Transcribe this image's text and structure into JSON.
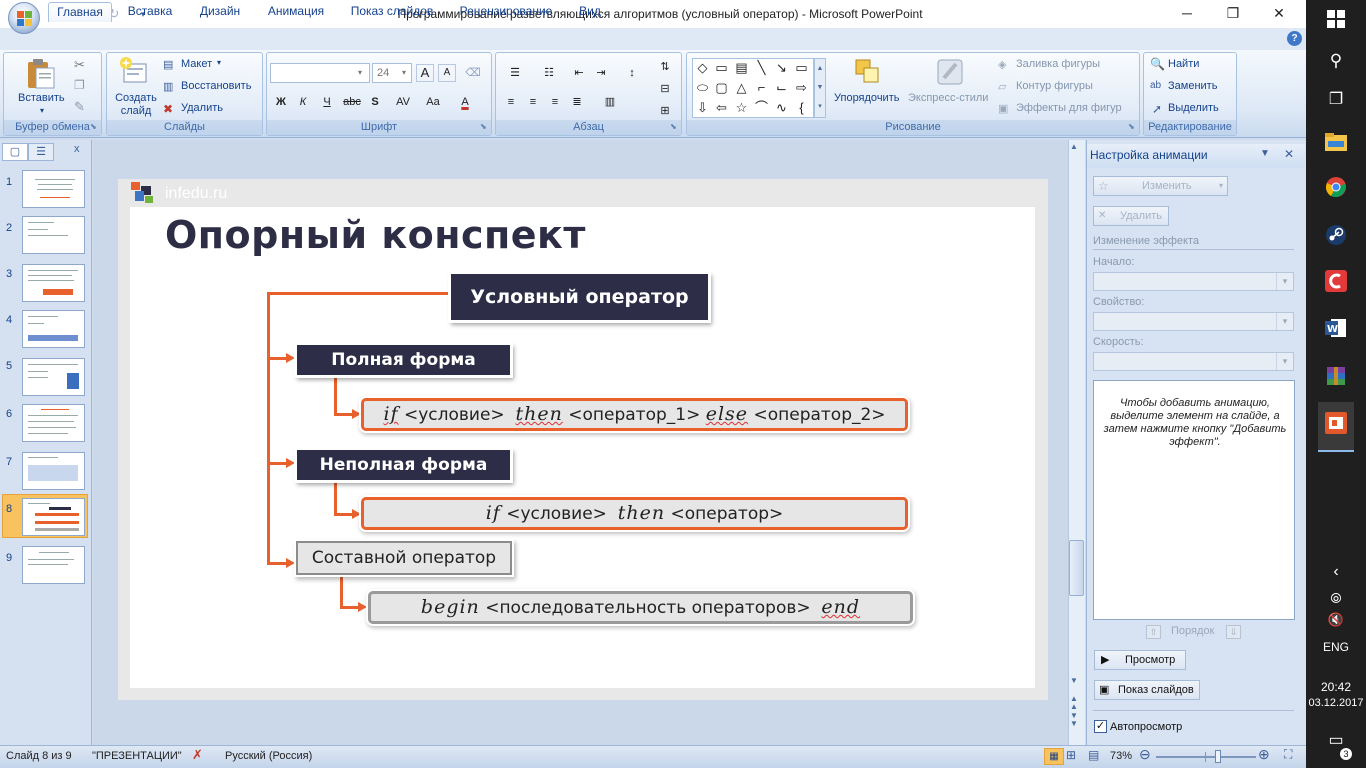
{
  "app": {
    "window_title": "Программирование разветвляющихся алгоритмов (условный оператор) - Microsoft PowerPoint",
    "minimize_glyph": "─",
    "maximize_glyph": "❐",
    "close_glyph": "✕"
  },
  "tabs": [
    "Главная",
    "Вставка",
    "Дизайн",
    "Анимация",
    "Показ слайдов",
    "Рецензирование",
    "Вид"
  ],
  "ribbon": {
    "clipboard": {
      "paste_label": "Вставить",
      "group_label": "Буфер обмена"
    },
    "slides": {
      "new_slide_label": "Создать слайд",
      "layout_label": "Макет",
      "reset_label": "Восстановить",
      "delete_label": "Удалить",
      "group_label": "Слайды"
    },
    "font": {
      "font_name": "",
      "font_size": "24",
      "group_label": "Шрифт",
      "bold": "Ж",
      "italic": "К",
      "underline": "Ч",
      "strike": "abc",
      "shadow": "S",
      "spacing": "AV",
      "case": "Aa",
      "grow": "A",
      "shrink": "A",
      "color": "A"
    },
    "paragraph": {
      "group_label": "Абзац"
    },
    "drawing": {
      "arrange_label": "Упорядочить",
      "quick_styles_label": "Экспресс-стили",
      "fill_label": "Заливка фигуры",
      "outline_label": "Контур фигуры",
      "effects_label": "Эффекты для фигур",
      "group_label": "Рисование"
    },
    "editing": {
      "find_label": "Найти",
      "replace_label": "Заменить",
      "select_label": "Выделить",
      "group_label": "Редактирование"
    }
  },
  "slides_pane": {
    "slide_numbers": [
      "1",
      "2",
      "3",
      "4",
      "5",
      "6",
      "7",
      "8",
      "9"
    ],
    "selected": 8
  },
  "slide": {
    "site_label": "infedu.ru",
    "title": "Опорный конспект",
    "root_box": "Условный оператор",
    "full_form": "Полная форма",
    "full_syntax": {
      "if": "if",
      "cond": "<условие>",
      "then": "then",
      "op1": "<оператор_1>",
      "else": "else",
      "op2": "<оператор_2>"
    },
    "partial_form": "Неполная форма",
    "partial_syntax": {
      "if": "if",
      "cond": "<условие>",
      "then": "then",
      "op": "<оператор>"
    },
    "compound": "Составной оператор",
    "compound_syntax": {
      "begin": "begin",
      "seq": "<последовательность операторов>",
      "end": "end"
    }
  },
  "task_pane": {
    "title": "Настройка анимации",
    "change_btn": "Изменить",
    "delete_btn": "Удалить",
    "effect_header": "Изменение эффекта",
    "start_label": "Начало:",
    "property_label": "Свойство:",
    "speed_label": "Скорость:",
    "hint": "Чтобы добавить анимацию, выделите элемент на слайде, а затем нажмите кнопку \"Добавить эффект\".",
    "order_label": "Порядок",
    "preview_btn": "Просмотр",
    "slideshow_btn": "Показ слайдов",
    "autopreview_label": "Автопросмотр"
  },
  "status": {
    "slide_info": "Слайд 8 из 9",
    "theme": "\"ПРЕЗЕНТАЦИИ\"",
    "language": "Русский (Россия)",
    "zoom": "73%",
    "zoom_level": 0.62
  },
  "taskbar": {
    "lang": "ENG",
    "time": "20:42",
    "date": "03.12.2017",
    "notif_count": "3"
  }
}
